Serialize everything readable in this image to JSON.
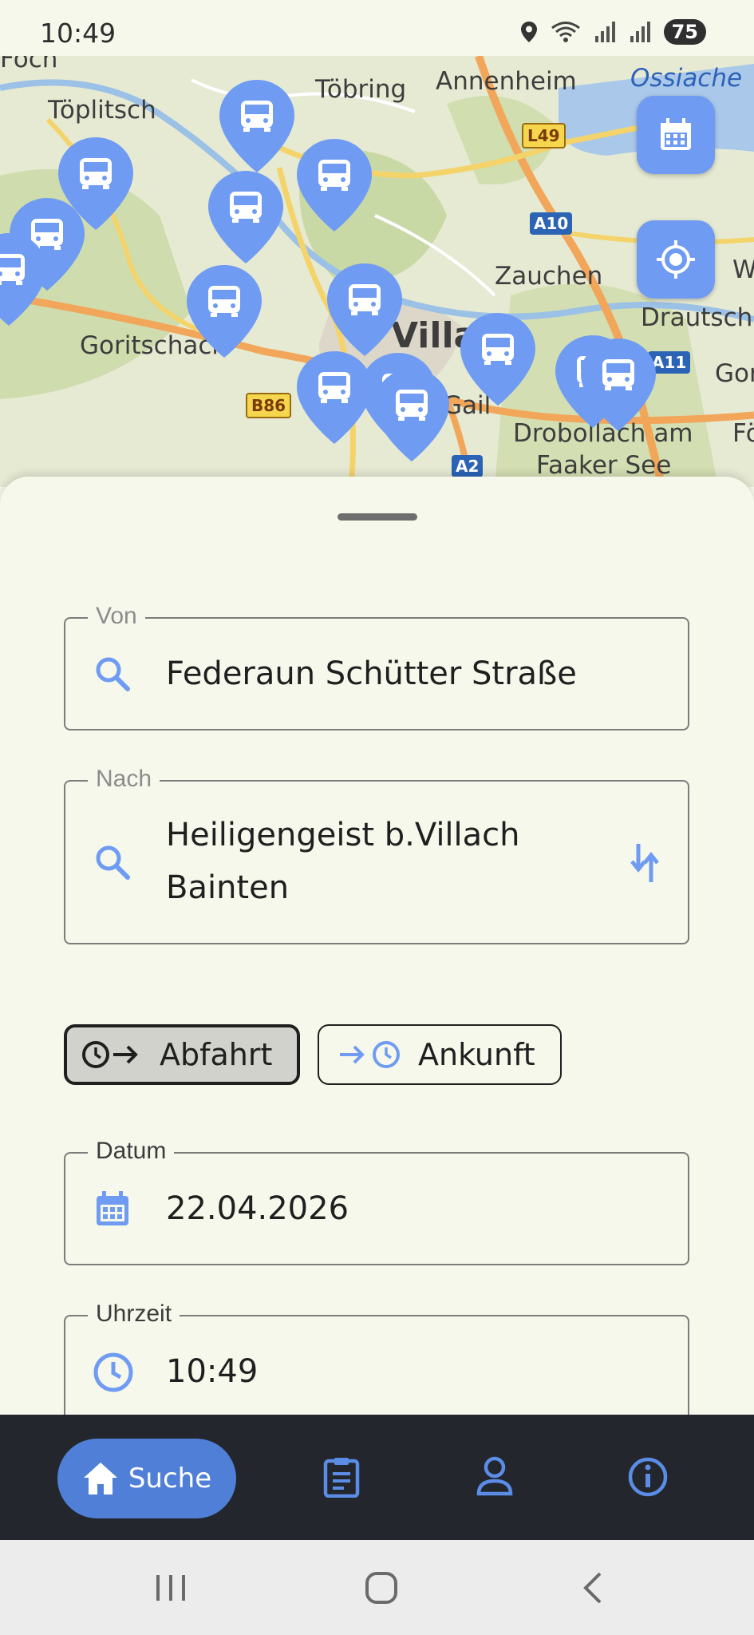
{
  "status": {
    "time": "10:49",
    "battery": "75"
  },
  "map": {
    "labels": {
      "poch": "Föch",
      "toeplitsch": "Töplitsch",
      "toebring": "Töbring",
      "annenheim": "Annenheim",
      "ossiach": "Ossiache",
      "zauchen": "Zauchen",
      "w": "W",
      "drautsch": "Drautsch",
      "goritschach": "Goritschach",
      "villach": "Villa",
      "gail": "Gail",
      "gon": "Gon",
      "drobollach": "Drobollach am",
      "faaker": "Faaker See",
      "fo": "Fö"
    },
    "roads": {
      "l49": "L49",
      "a10": "A10",
      "b86": "B86",
      "a11": "A11",
      "a2": "A2"
    }
  },
  "form": {
    "from": {
      "label": "Von",
      "value": "Federaun Schütter Straße"
    },
    "to": {
      "label": "Nach",
      "line1": "Heiligengeist b.Villach",
      "line2": "Bainten"
    },
    "mode": {
      "departure": "Abfahrt",
      "arrival": "Ankunft"
    },
    "date": {
      "label": "Datum",
      "value": "22.04.2026"
    },
    "time": {
      "label": "Uhrzeit",
      "value": "10:49"
    }
  },
  "nav": {
    "home": "Suche"
  },
  "colors": {
    "accent": "#4f7fd6",
    "pin": "#6f9cf2",
    "navbar": "#23262d"
  }
}
